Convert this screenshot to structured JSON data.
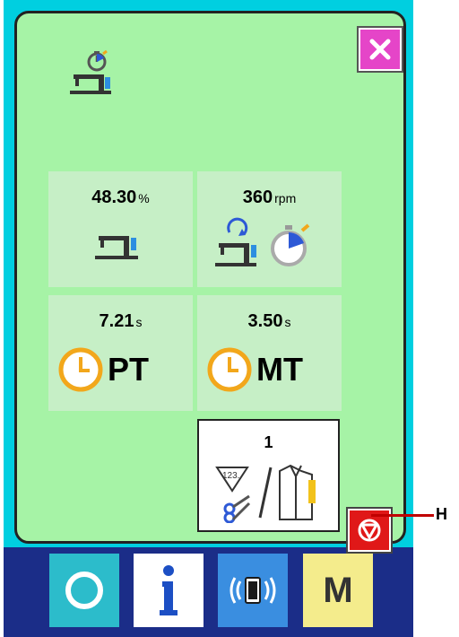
{
  "tiles": {
    "ratio": {
      "value": "48.30",
      "unit": "%"
    },
    "speed": {
      "value": "360",
      "unit": "rpm"
    },
    "pitch_time": {
      "value": "7.21",
      "unit": "s",
      "label": "PT"
    },
    "machine_time": {
      "value": "3.50",
      "unit": "s",
      "label": "MT"
    }
  },
  "counter": {
    "value": "1"
  },
  "callout": {
    "label": "H"
  },
  "bottom_bar": {
    "mode_label": "M"
  },
  "icons": {
    "title": "sewing-machine-timer-icon",
    "close": "close-icon",
    "stop": "emergency-stop-icon",
    "reset": "reset-icon",
    "info": "info-icon",
    "comm": "communication-icon"
  },
  "colors": {
    "panel": "#a6f3a6",
    "tile": "#c6efc6",
    "close_button": "#e545c8",
    "stop_button": "#e01818",
    "clock": "#f2a71b",
    "frame": "#1b2d88"
  }
}
